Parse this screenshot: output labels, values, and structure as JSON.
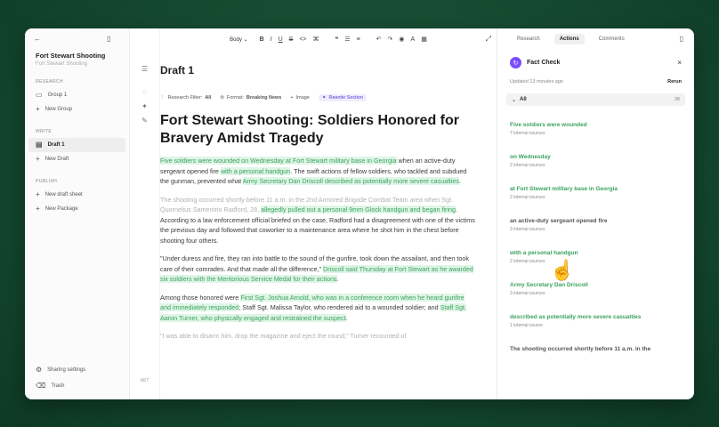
{
  "sidebar": {
    "project_title": "Fort Stewart Shooting",
    "project_subtitle": "Fort Stewart Shooting",
    "sections": {
      "research": "RESEARCH",
      "write": "WRITE",
      "publish": "PUBLISH"
    },
    "items": {
      "group": "Group 1",
      "new_group": "New Group",
      "draft": "Draft 1",
      "new_draft": "New Draft",
      "new_draft_sheet": "New draft sheet",
      "new_package": "New Package"
    },
    "bottom": {
      "sharing": "Sharing settings",
      "trash": "Trash"
    },
    "gutter_count": "667"
  },
  "toolbar": {
    "style": "Body",
    "bold": "B",
    "italic": "I",
    "underline": "U",
    "strike": "S",
    "code": "<>",
    "link": "⌘",
    "quote": "❝",
    "bullets": "☰",
    "numbered": "≡",
    "undo": "↶",
    "redo": "↷",
    "preview": "◉",
    "spell": "A",
    "table": "▦"
  },
  "editor": {
    "draft_title": "Draft 1",
    "chips": {
      "research_filter_label": "Research Filter:",
      "research_filter_value": "All",
      "format_label": "Format:",
      "format_value": "Breaking News",
      "image": "Image",
      "rewrite": "Rewrite Section"
    },
    "headline": "Fort Stewart Shooting: Soldiers Honored for Bravery Amidst Tragedy",
    "p1": {
      "h1": "Five soldiers were wounded on Wednesday at Fort Stewart military base in Georgia",
      "t1": " when an active-duty sergeant opened fire ",
      "h2": "with a personal handgun",
      "t2": ". The swift actions of fellow soldiers, who tackled and subdued the gunman, prevented what ",
      "h3": "Army Secretary Dan Driscoll described as potentially more severe casualties",
      "t3": "."
    },
    "p2": {
      "m1": "The shooting occurred shortly before 11 a.m. in the 2nd Armored Brigade Combat Team area when Sgt. Quornelius Samentrio Radford, 28, ",
      "h1": "allegedly pulled out a personal 9mm Glock handgun and began firing",
      "t1": ". According to a law enforcement official briefed on the case, Radford had a disagreement with one of the victims the previous day and followed that coworker to a maintenance area where he shot him in the chest before shooting four others."
    },
    "p3": {
      "t1": "\"Under duress and fire, they ran into battle to the sound of the gunfire, took down the assailant, and then took care of their comrades. And that made all the difference,\" ",
      "h1": "Driscoll said Thursday at Fort Stewart as he awarded six soldiers with the Meritorious Service Medal for their actions",
      "t2": "."
    },
    "p4": {
      "t1": "Among those honored were ",
      "h1": "First Sgt. Joshua Arnold, who was in a conference room when he heard gunfire and immediately responded",
      "t2": "; Staff Sgt. Malissa Taylor, who rendered aid to a wounded soldier; and ",
      "h2": "Staff Sgt. Aaron Turner, who physically engaged and restrained the suspect",
      "t3": "."
    },
    "p5": {
      "m1": "\"I was able to disarm him, drop the magazine and eject the round,\" Turner recounted of"
    }
  },
  "panel": {
    "tabs": {
      "research": "Research",
      "actions": "Actions",
      "comments": "Comments"
    },
    "fact_check": {
      "title": "Fact Check",
      "updated": "Updated 13 minutes ago",
      "rerun": "Rerun",
      "filter_label": "All",
      "filter_count": "38"
    },
    "claims": [
      {
        "text": "Five soldiers were wounded",
        "sources": "7 internal sources"
      },
      {
        "text": "on Wednesday",
        "sources": "2 internal sources"
      },
      {
        "text": "at Fort Stewart military base in Georgia",
        "sources": "2 internal sources"
      },
      {
        "text": "an active-duty sergeant opened fire",
        "sources": "3 internal sources"
      },
      {
        "text": "with a personal handgun",
        "sources": "2 internal sources"
      },
      {
        "text": "Army Secretary Dan Driscoll",
        "sources": "3 internal sources"
      },
      {
        "text": "described as potentially more severe casualties",
        "sources": "1 internal source"
      },
      {
        "text": "The shooting occurred shortly before 11 a.m. in the",
        "sources": ""
      }
    ]
  },
  "colors": {
    "background": "#154a30",
    "highlight_bg": "#dff5e6",
    "highlight_text": "#3aa35f",
    "accent": "#7c4dff"
  }
}
